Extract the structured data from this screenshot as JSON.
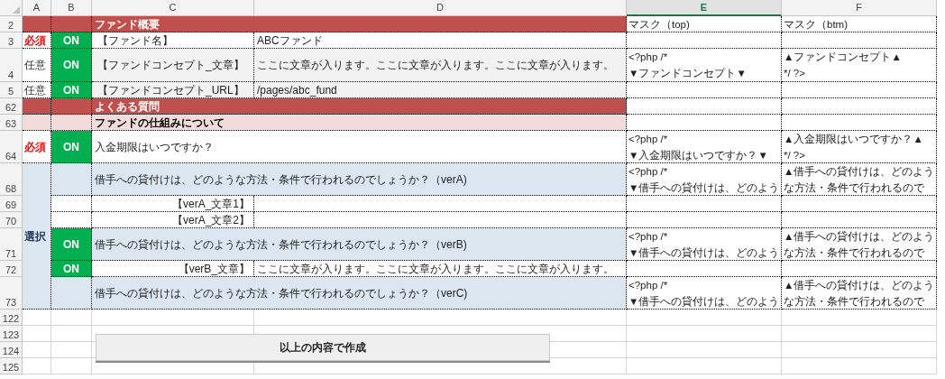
{
  "column_headers": [
    {
      "label": "A",
      "selected": false
    },
    {
      "label": "B",
      "selected": false
    },
    {
      "label": "C",
      "selected": false
    },
    {
      "label": "D",
      "selected": false
    },
    {
      "label": "E",
      "selected": true
    },
    {
      "label": "F",
      "selected": false
    }
  ],
  "rows": [
    {
      "kind": "section",
      "number": "2",
      "title": "ファンド概要",
      "mask_top": [
        "マスク（top)"
      ],
      "mask_btm": [
        "マスク（btm)"
      ]
    },
    {
      "kind": "field",
      "number": "3",
      "requirement": {
        "kind": "required",
        "text": "必須"
      },
      "toggle": "ON",
      "shaded": false,
      "label": "【ファンド名】",
      "value": "ABCファンド"
    },
    {
      "kind": "field",
      "number": "4",
      "requirement": {
        "kind": "optional",
        "text": "任意"
      },
      "toggle": "ON",
      "shaded": true,
      "label": "【ファンドコンセプト_文章】",
      "value": "ここに文章が入ります。ここに文章が入ります。ここに文章が入ります。",
      "mask_top": [
        "<?php /*",
        "▼ファンドコンセプト▼"
      ],
      "mask_btm": [
        "▲ファンドコンセプト▲",
        "*/ ?>"
      ]
    },
    {
      "kind": "field",
      "number": "5",
      "requirement": {
        "kind": "optional",
        "text": "任意"
      },
      "toggle": "ON",
      "shaded": true,
      "label": "【ファンドコンセプト_URL】",
      "value": "/pages/abc_fund"
    },
    {
      "kind": "section",
      "number": "62",
      "title": "よくある質問"
    },
    {
      "kind": "subsection",
      "number": "63",
      "title": "ファンドの仕組みについて"
    },
    {
      "kind": "question",
      "number": "64",
      "requirement": {
        "kind": "required",
        "text": "必須"
      },
      "toggle": "ON",
      "shaded": false,
      "title": "入金期限はいつですか？",
      "mask_top": [
        "<?php /*",
        "▼入金期限はいつですか？▼"
      ],
      "mask_btm": [
        "▲入金期限はいつですか？▲",
        "*/ ?>"
      ]
    },
    {
      "kind": "group",
      "requirement": {
        "kind": "choice",
        "text": "選択"
      },
      "children": [
        {
          "kind": "question",
          "number": "68",
          "shaded": true,
          "title": "借手への貸付けは、どのような方法・条件で行われるのでしょうか？（verA)",
          "mask_top": [
            "<?php /*",
            "▼借手への貸付けは、どのよう"
          ],
          "mask_btm": [
            "▲借手への貸付けは、どのよう",
            "な方法・条件で行われるので"
          ]
        },
        {
          "kind": "sublabel",
          "number": "69",
          "label": "【verA_文章1】"
        },
        {
          "kind": "sublabel",
          "number": "70",
          "label": "【verA_文章2】"
        },
        {
          "kind": "question",
          "number": "71",
          "toggle": "ON",
          "shaded": true,
          "title": "借手への貸付けは、どのような方法・条件で行われるのでしょうか？（verB)",
          "mask_top": [
            "<?php /*",
            "▼借手への貸付けは、どのよう"
          ],
          "mask_btm": [
            "▲借手への貸付けは、どのよう",
            "な方法・条件で行われるので"
          ]
        },
        {
          "kind": "sublabel",
          "number": "72",
          "toggle": "ON",
          "label": "【verB_文章】",
          "value": "ここに文章が入ります。ここに文章が入ります。ここに文章が入ります。"
        },
        {
          "kind": "question",
          "number": "73",
          "shaded": true,
          "title": "借手への貸付けは、どのような方法・条件で行われるのでしょうか？（verC)",
          "mask_top": [
            "<?php /*",
            "▼借手への貸付けは、どのよう"
          ],
          "mask_btm": [
            "▲借手への貸付けは、どのよう",
            "な方法・条件で行われるので"
          ]
        }
      ]
    }
  ],
  "empty_rows": [
    "122",
    "123",
    "124",
    "125"
  ],
  "button": "以上の内容で作成"
}
